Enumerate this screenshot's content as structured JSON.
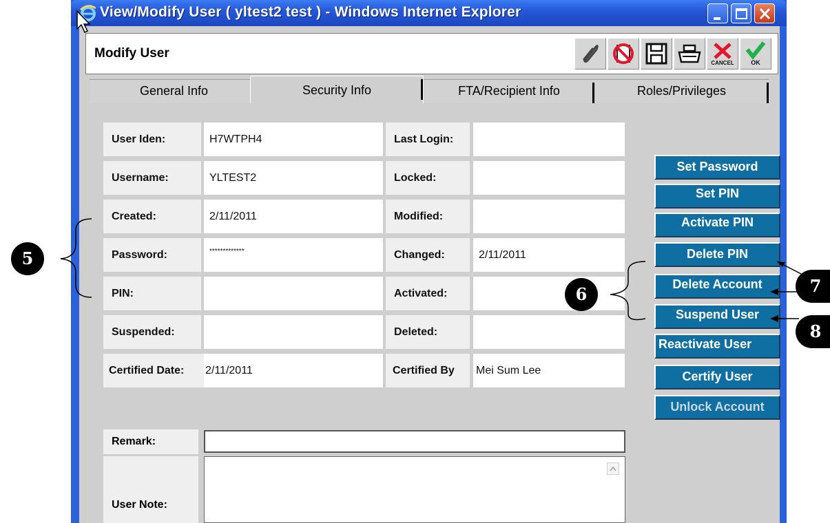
{
  "window": {
    "title": "View/Modify User ( yltest2 test ) - Windows Internet Explorer",
    "icon": "ie-icon",
    "controls": [
      "minimize-icon",
      "maximize-icon",
      "close-icon"
    ]
  },
  "header": {
    "title": "Modify User",
    "toolbar": [
      {
        "name": "attach-icon"
      },
      {
        "name": "no-entry-icon"
      },
      {
        "name": "save-icon"
      },
      {
        "name": "print-icon"
      },
      {
        "name": "cancel-icon",
        "caption": "CANCEL"
      },
      {
        "name": "ok-icon",
        "caption": "OK"
      }
    ]
  },
  "tabs": [
    {
      "label": "General Info"
    },
    {
      "label": "Security Info",
      "active": true
    },
    {
      "label": "FTA/Recipient Info"
    },
    {
      "label": "Roles/Privileges"
    }
  ],
  "fields": {
    "user_iden": {
      "label": "User Iden:",
      "value": "H7WTPH4"
    },
    "last_login": {
      "label": "Last Login:",
      "value": ""
    },
    "username": {
      "label": "Username:",
      "value": "YLTEST2"
    },
    "locked": {
      "label": "Locked:",
      "value": ""
    },
    "created": {
      "label": "Created:",
      "value": "2/11/2011"
    },
    "modified": {
      "label": "Modified:",
      "value": ""
    },
    "password": {
      "label": "Password:",
      "value": "*************"
    },
    "changed": {
      "label": "Changed:",
      "value": "2/11/2011"
    },
    "pin": {
      "label": "PIN:",
      "value": ""
    },
    "activated": {
      "label": "Activated:",
      "value": ""
    },
    "suspended": {
      "label": "Suspended:",
      "value": ""
    },
    "deleted": {
      "label": "Deleted:",
      "value": ""
    },
    "certified_date": {
      "label": "Certified Date:",
      "value": "2/11/2011"
    },
    "certified_by": {
      "label": "Certified By",
      "value": "Mei Sum Lee"
    },
    "remark": {
      "label": "Remark:",
      "value": ""
    },
    "user_note": {
      "label": "User Note:",
      "value": ""
    }
  },
  "actions": {
    "set_password": "Set Password",
    "set_pin": "Set PIN",
    "activate_pin": "Activate PIN",
    "delete_pin": "Delete PIN",
    "delete_account": "Delete Account",
    "suspend_user": "Suspend User",
    "reactivate_user": "Reactivate User",
    "certify_user": "Certify User",
    "unlock_account": "Unlock Account"
  },
  "callouts": {
    "c5": "5",
    "c6": "6",
    "c7": "7",
    "c8": "8"
  },
  "colors": {
    "titlebar": "#2658d8",
    "action_button": "#0f6fa3",
    "panel": "#cfcfcf"
  }
}
